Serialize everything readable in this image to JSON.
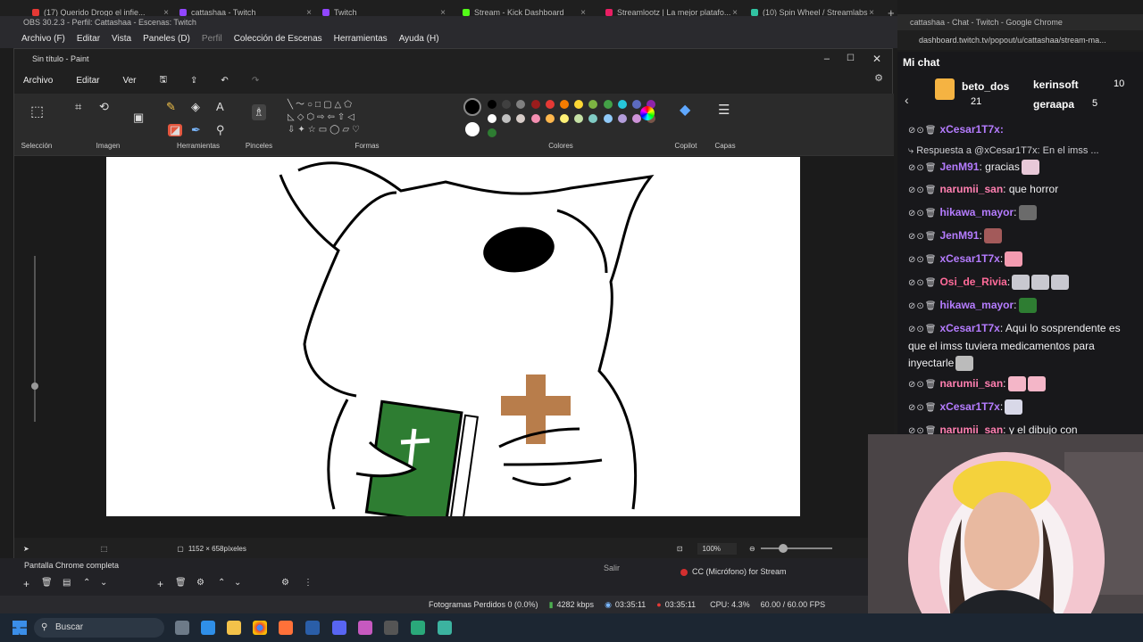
{
  "browser_tabs": [
    {
      "label": "(17) Querido Drogo el infie...",
      "color": "#e53935"
    },
    {
      "label": "cattashaa - Twitch",
      "color": "#9146ff"
    },
    {
      "label": "Twitch",
      "color": "#9146ff"
    },
    {
      "label": "Stream - Kick Dashboard",
      "color": "#53fc18"
    },
    {
      "label": "Streamlootz | La mejor platafo...",
      "color": "#e91e63"
    },
    {
      "label": "(10) Spin Wheel / Streamlabs",
      "color": "#31c3a2"
    }
  ],
  "obs": {
    "title": "OBS 30.2.3 - Perfil: Cattashaa - Escenas: Twitch",
    "menu": [
      "Archivo (F)",
      "Editar",
      "Vista",
      "Paneles (D)",
      "Perfil",
      "Colección de Escenas",
      "Herramientas",
      "Ayuda (H)"
    ],
    "source_label": "Pantalla Chrome completa",
    "audio_label": "CC (Micrófono) for Stream",
    "exit_label": "Salir",
    "status": {
      "dropped": "Fotogramas Perdidos 0 (0.0%)",
      "bitrate": "4282 kbps",
      "rec_time": "03:35:11",
      "stream_time": "03:35:11",
      "cpu": "CPU: 4.3%",
      "fps": "60.00 / 60.00 FPS"
    }
  },
  "paint": {
    "title": "Sin título - Paint",
    "menu": [
      "Archivo",
      "Editar",
      "Ver"
    ],
    "groups": {
      "selection": "Selección",
      "image": "Imagen",
      "tools": "Herramientas",
      "brushes": "Pinceles",
      "shapes": "Formas",
      "colors": "Colores",
      "copilot": "Copilot",
      "layers": "Capas"
    },
    "canvas_size": "1152 × 658píxeles",
    "zoom": "100%",
    "palette": [
      "#000000",
      "#404040",
      "#808080",
      "#9b1c1c",
      "#e53935",
      "#f57c00",
      "#fdd835",
      "#7cb342",
      "#43a047",
      "#26c6da",
      "#5c6bc0",
      "#8e24aa",
      "#ffffff",
      "#c0c0c0",
      "#d7ccc8",
      "#f48fb1",
      "#ffb74d",
      "#fff176",
      "#c5e1a5",
      "#80cbc4",
      "#90caf9",
      "#b39ddb",
      "#ce93d8",
      "#795548",
      "#2e7d32"
    ]
  },
  "chrome_chat": {
    "window_title": "cattashaa - Chat - Twitch - Google Chrome",
    "url": "dashboard.twitch.tv/popout/u/cattashaa/stream-ma..."
  },
  "chat": {
    "header": "Mi chat",
    "leaderboard": [
      {
        "name": "beto_dos",
        "count": "21"
      },
      {
        "name": "kerinsoft",
        "count": "10"
      },
      {
        "name": "geraapa",
        "count": "5"
      }
    ],
    "top_user": "xCesar1T7x:",
    "reply_header": "Respuesta a @xCesar1T7x: En el imss ...",
    "messages": [
      {
        "user": "JenM91",
        "color": "#b57cff",
        "text": ": gracias"
      },
      {
        "user": "narumii_san",
        "color": "#ff7fb0",
        "text": ": que horror"
      },
      {
        "user": "hikawa_mayor",
        "color": "#b57cff",
        "text": ":"
      },
      {
        "user": "JenM91",
        "color": "#b57cff",
        "text": ":"
      },
      {
        "user": "xCesar1T7x",
        "color": "#b57cff",
        "text": ":"
      },
      {
        "user": "Osi_de_Rivia",
        "color": "#ff6b9a",
        "text": ":"
      },
      {
        "user": "hikawa_mayor",
        "color": "#b57cff",
        "text": ":"
      },
      {
        "user": "xCesar1T7x",
        "color": "#b57cff",
        "text": ": Aqui lo sosprendente es que el imss tuviera medicamentos para inyectarle"
      },
      {
        "user": "narumii_san",
        "color": "#ff7fb0",
        "text": ":"
      },
      {
        "user": "xCesar1T7x",
        "color": "#b57cff",
        "text": ":"
      },
      {
        "user": "narumii_san",
        "color": "#ff7fb0",
        "text": ": y el dibujo con"
      }
    ]
  },
  "taskbar": {
    "search_placeholder": "Buscar"
  }
}
